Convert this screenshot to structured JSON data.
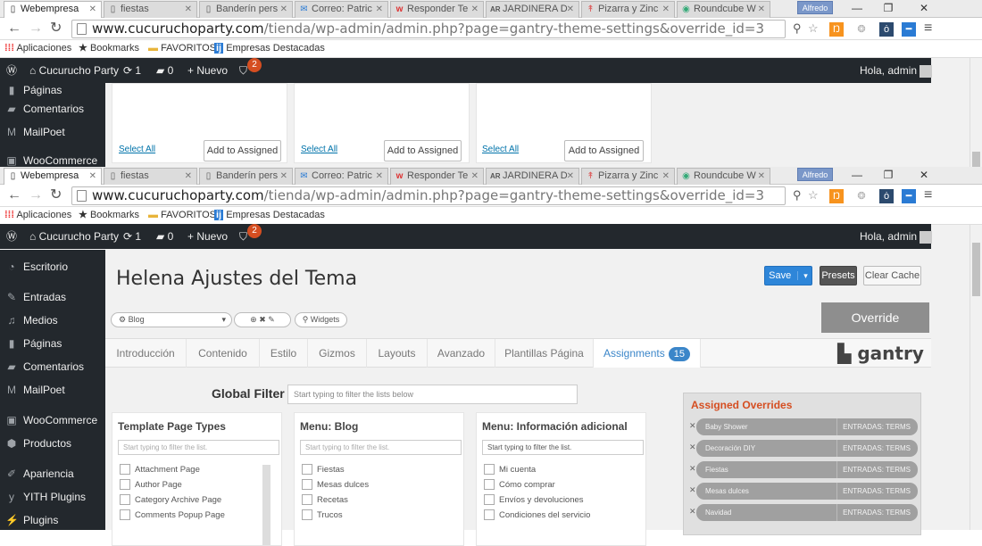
{
  "browser": {
    "tabs": [
      {
        "label": "Webempresa",
        "icon": "page-icon",
        "active": true
      },
      {
        "label": "fiestas",
        "icon": "page-icon"
      },
      {
        "label": "Banderín pers",
        "icon": "page-icon"
      },
      {
        "label": "Correo: Patric",
        "icon": "mail-icon"
      },
      {
        "label": "Responder Te",
        "icon": "w-icon"
      },
      {
        "label": "JARDINERA D",
        "icon": "ar-icon"
      },
      {
        "label": "Pizarra y Zinc",
        "icon": "pin-icon"
      },
      {
        "label": "Roundcube W",
        "icon": "roundcube-icon"
      }
    ],
    "user_badge": "Alfredo",
    "url_host": "www.cucuruchoparty.com",
    "url_path": "/tienda/wp-admin/admin.php?page=gantry-theme-settings&override_id=3",
    "bookmarks": [
      "Aplicaciones",
      "Bookmarks",
      "FAVORITOS",
      "Empresas Destacadas"
    ]
  },
  "adminbar": {
    "site": "Cucurucho Party",
    "updates": "1",
    "comments": "0",
    "new": "Nuevo",
    "notif_count": "2",
    "greeting": "Hola, admin"
  },
  "top_window": {
    "sidebar": [
      "Páginas",
      "Comentarios",
      "MailPoet",
      "WooCommerce"
    ],
    "select_all": "Select All",
    "add_to_assigned": "Add to Assigned"
  },
  "sidebar": [
    {
      "label": "Escritorio",
      "icon": "dashboard-icon"
    },
    {
      "label": "Entradas",
      "icon": "pin-icon"
    },
    {
      "label": "Medios",
      "icon": "media-icon"
    },
    {
      "label": "Páginas",
      "icon": "pages-icon"
    },
    {
      "label": "Comentarios",
      "icon": "comments-icon"
    },
    {
      "label": "MailPoet",
      "icon": "mailpoet-icon"
    },
    {
      "label": "WooCommerce",
      "icon": "woo-icon"
    },
    {
      "label": "Productos",
      "icon": "products-icon"
    },
    {
      "label": "Apariencia",
      "icon": "appearance-icon"
    },
    {
      "label": "YITH Plugins",
      "icon": "yith-icon"
    },
    {
      "label": "Plugins",
      "icon": "plugins-icon"
    }
  ],
  "page": {
    "title": "Helena Ajustes del Tema",
    "save": "Save",
    "presets": "Presets",
    "clear_cache": "Clear Cache",
    "preset_select": "Blog",
    "widgets": "Widgets",
    "override": "Override"
  },
  "nav_tabs": [
    "Introducción",
    "Contenido",
    "Estilo",
    "Gizmos",
    "Layouts",
    "Avanzado",
    "Plantillas Página",
    "Assignments"
  ],
  "assignments_count": "15",
  "gantry_logo": "gantry",
  "global_filter": {
    "label": "Global Filter",
    "placeholder": "Start typing to filter the lists below"
  },
  "columns": [
    {
      "title": "Template Page Types",
      "placeholder": "Start typing to filter the list.",
      "items": [
        "Attachment Page",
        "Author Page",
        "Category Archive Page",
        "Comments Popup Page"
      ]
    },
    {
      "title": "Menu: Blog",
      "placeholder": "Start typing to filter the list.",
      "items": [
        "Fiestas",
        "Mesas dulces",
        "Recetas",
        "Trucos"
      ]
    },
    {
      "title": "Menu: Información adicional",
      "placeholder": "Start typing to filter the list.",
      "items": [
        "Mi cuenta",
        "Cómo comprar",
        "Envíos y devoluciones",
        "Condiciones del servicio"
      ]
    }
  ],
  "assigned": {
    "title": "Assigned Overrides",
    "items": [
      {
        "name": "Baby Shower",
        "type": "ENTRADAS: TERMS"
      },
      {
        "name": "Decoración DIY",
        "type": "ENTRADAS: TERMS"
      },
      {
        "name": "Fiestas",
        "type": "ENTRADAS: TERMS"
      },
      {
        "name": "Mesas dulces",
        "type": "ENTRADAS: TERMS"
      },
      {
        "name": "Navidad",
        "type": "ENTRADAS: TERMS"
      }
    ]
  }
}
